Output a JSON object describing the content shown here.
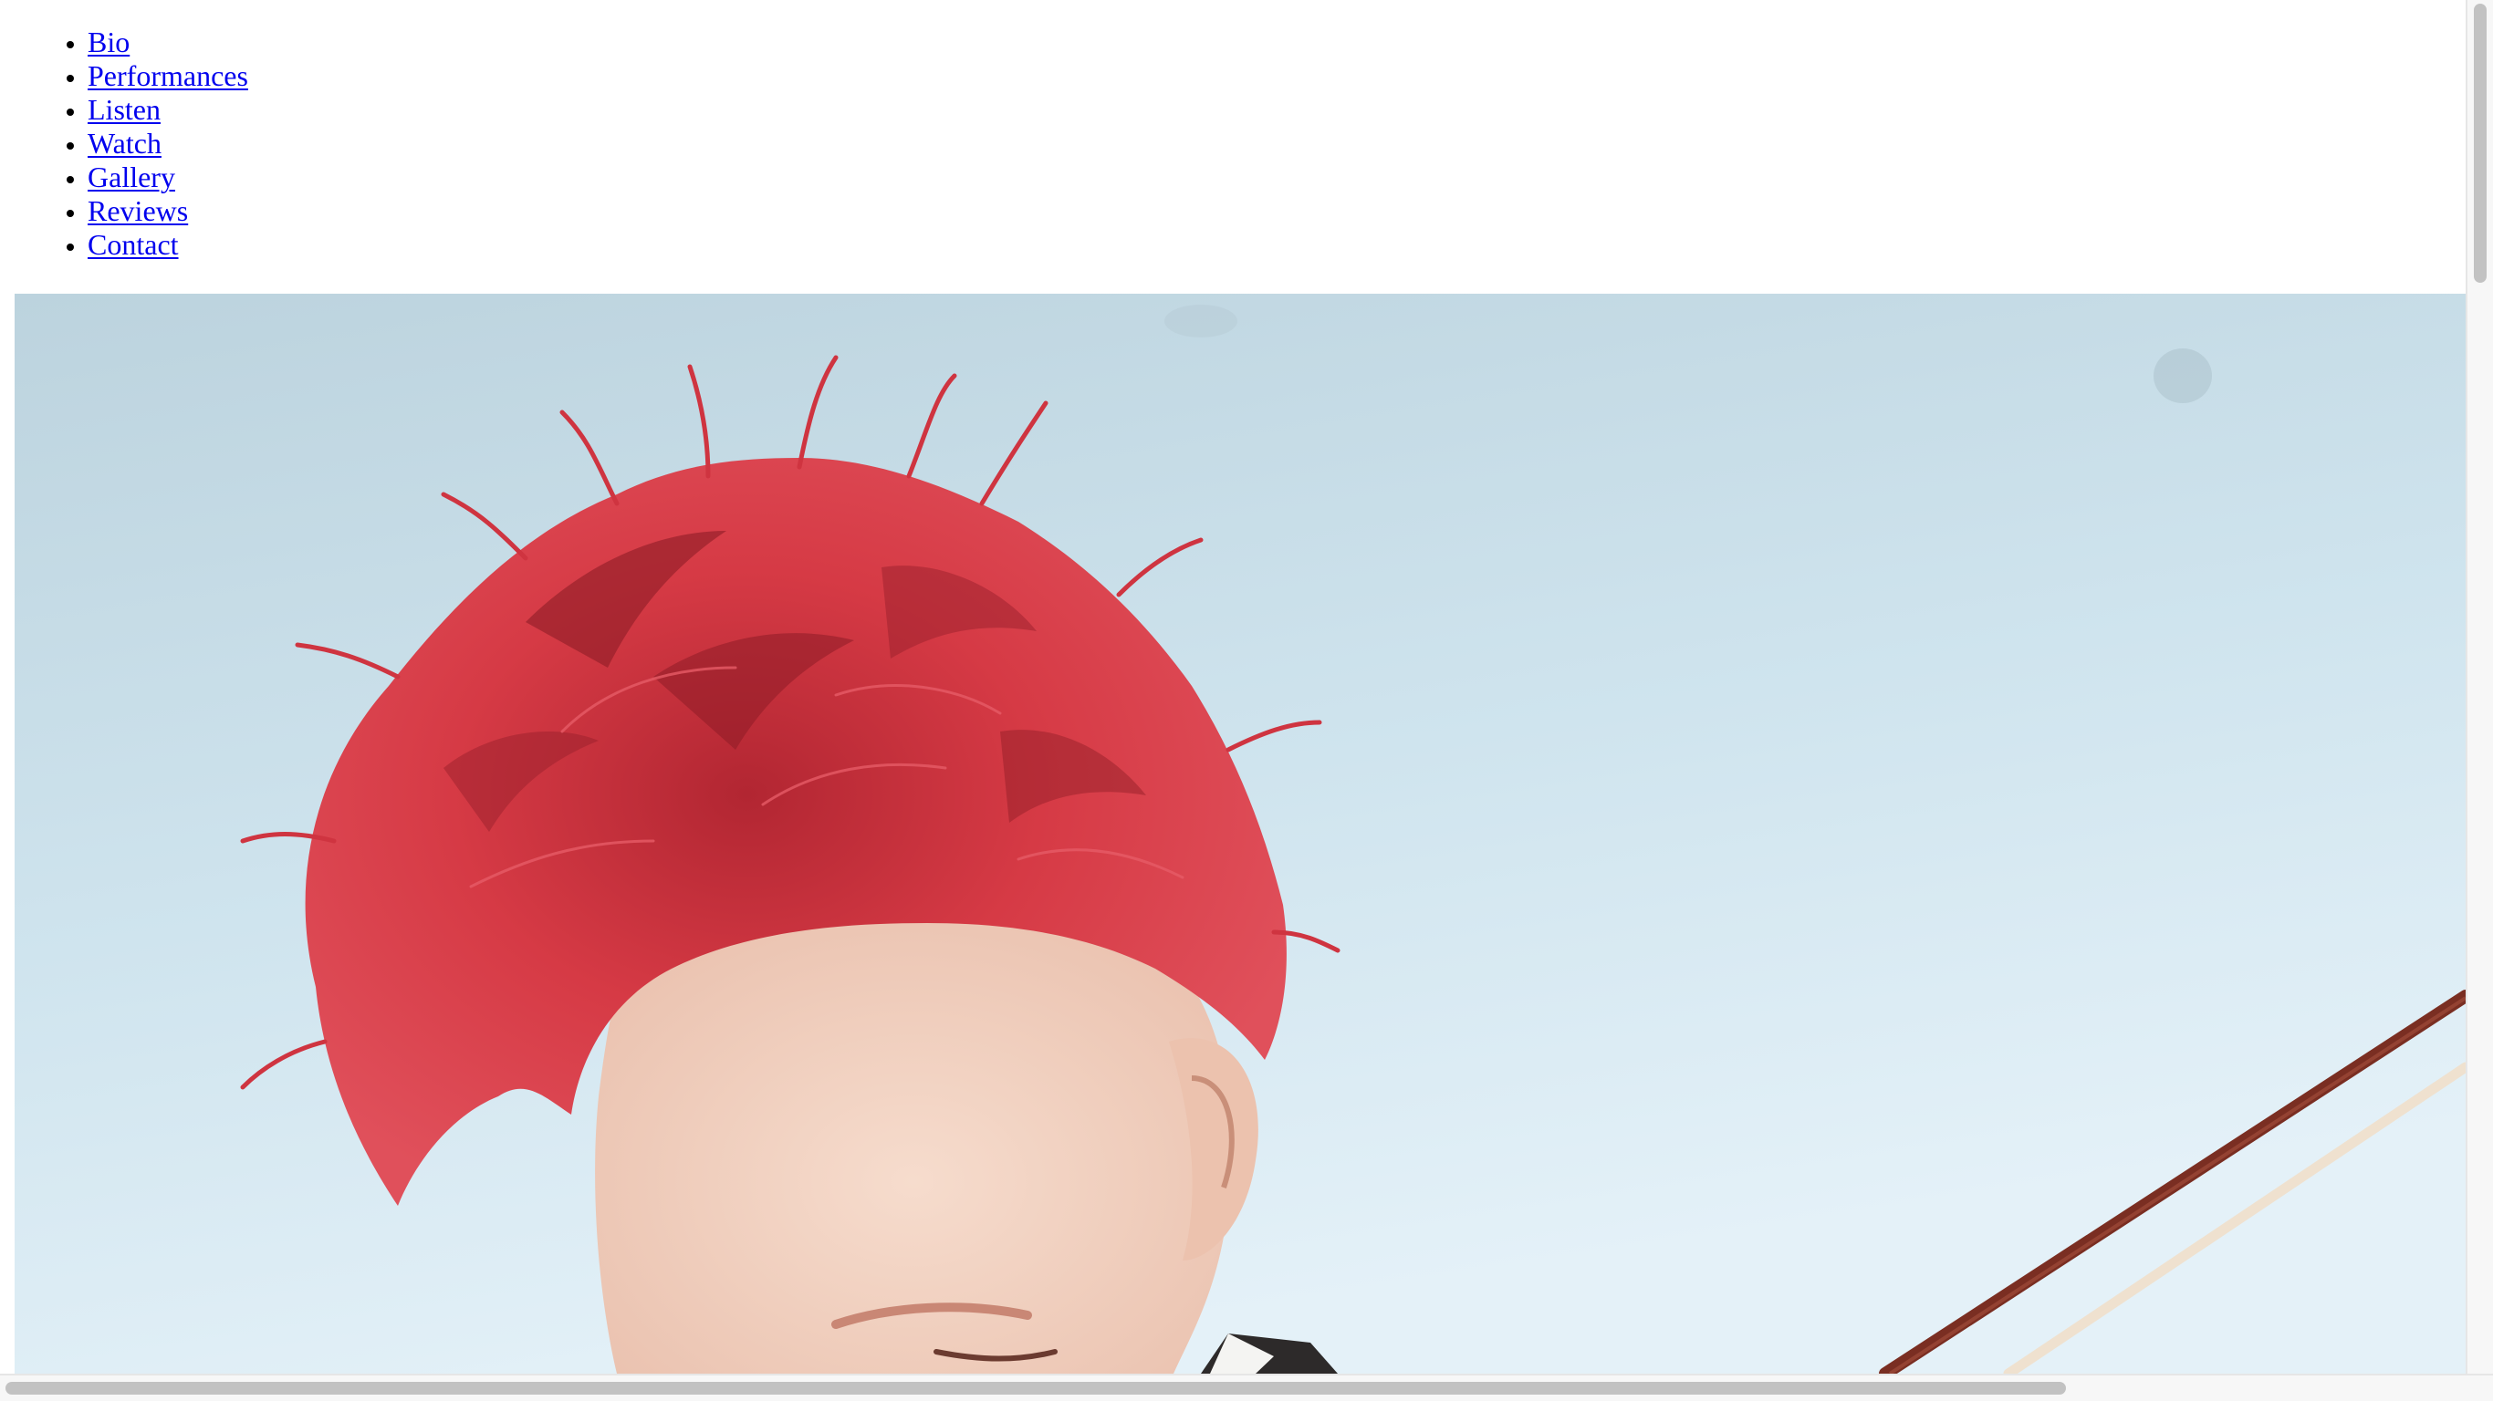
{
  "nav": {
    "items": [
      {
        "label": "Bio"
      },
      {
        "label": "Performances"
      },
      {
        "label": "Listen"
      },
      {
        "label": "Watch"
      },
      {
        "label": "Gallery"
      },
      {
        "label": "Reviews"
      },
      {
        "label": "Contact"
      }
    ]
  },
  "hero": {
    "subject": "red-haired violinist photo",
    "colors": {
      "sky_top": "#bcd3de",
      "sky_bottom": "#e4f1f8",
      "hair": "#d63a45",
      "hair_dark": "#8e1c26",
      "skin": "#f1d0bf",
      "bow_stick": "#7a2e22",
      "bow_hair": "#efe1cf"
    }
  },
  "colors": {
    "link": "#0000ee",
    "scrollbar_thumb": "#c2c2c2",
    "scrollbar_track": "#f7f7f7"
  }
}
